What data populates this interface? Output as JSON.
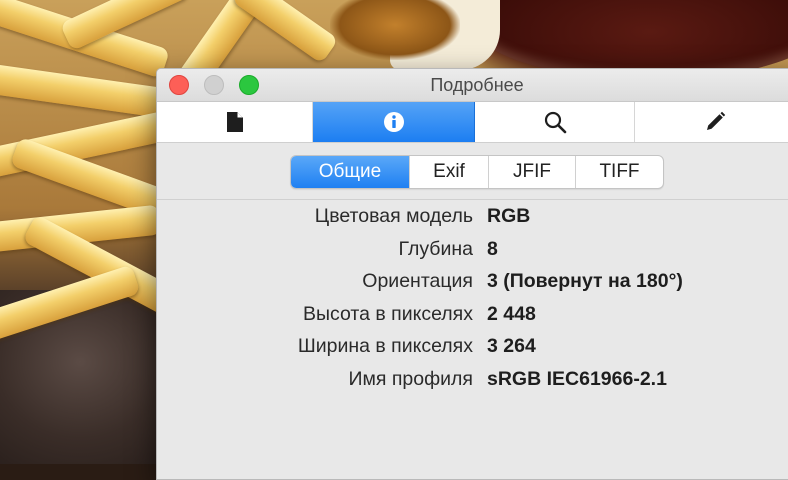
{
  "window": {
    "title": "Подробнее"
  },
  "toolbar": {
    "items": [
      {
        "icon": "document-icon",
        "selected": false
      },
      {
        "icon": "info-icon",
        "selected": true
      },
      {
        "icon": "search-icon",
        "selected": false
      },
      {
        "icon": "pencil-icon",
        "selected": false
      }
    ]
  },
  "tabs": [
    "Общие",
    "Exif",
    "JFIF",
    "TIFF"
  ],
  "selected_tab": "Общие",
  "properties": [
    {
      "label": "Цветовая модель",
      "value": "RGB"
    },
    {
      "label": "Глубина",
      "value": "8"
    },
    {
      "label": "Ориентация",
      "value": "3 (Повернут на 180°)"
    },
    {
      "label": "Высота в пикселях",
      "value": "2 448"
    },
    {
      "label": "Ширина в пикселях",
      "value": "3 264"
    },
    {
      "label": "Имя профиля",
      "value": "sRGB IEC61966-2.1"
    }
  ],
  "colors": {
    "accent": "#1f80f2",
    "close": "#fd5f57",
    "zoom": "#2bc73f"
  }
}
